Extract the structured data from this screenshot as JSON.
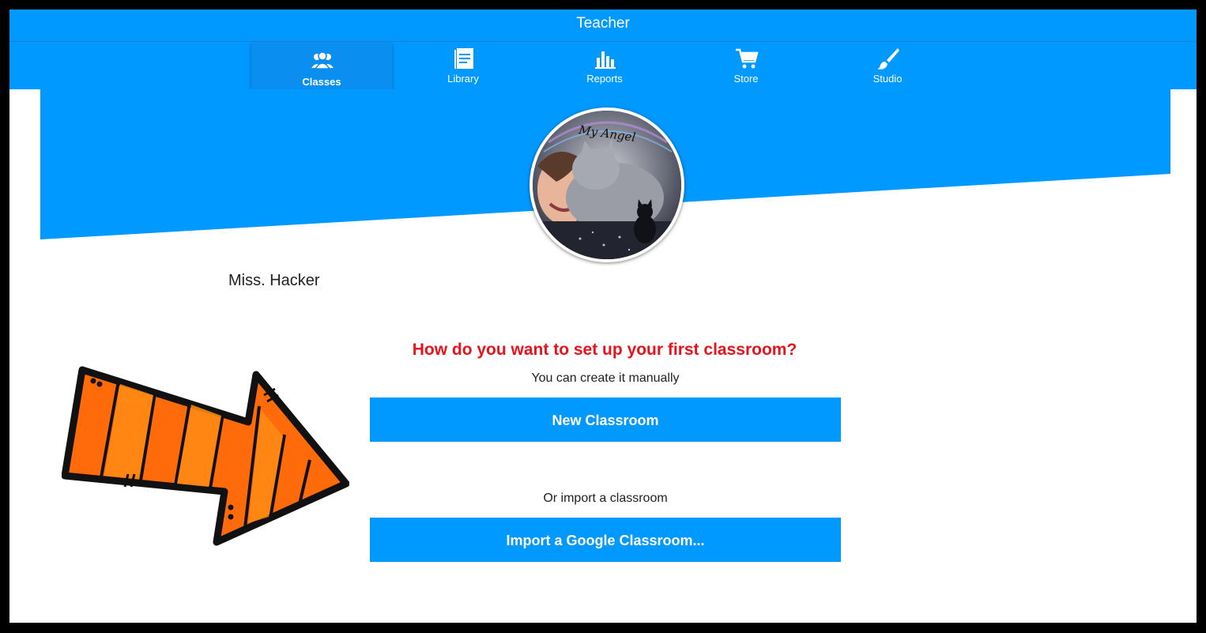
{
  "header": {
    "title": "Teacher"
  },
  "nav": {
    "items": [
      {
        "label": "Classes",
        "icon": "users-icon",
        "active": true
      },
      {
        "label": "Library",
        "icon": "book-icon",
        "active": false
      },
      {
        "label": "Reports",
        "icon": "bar-chart-icon",
        "active": false
      },
      {
        "label": "Store",
        "icon": "cart-icon",
        "active": false
      },
      {
        "label": "Studio",
        "icon": "paintbrush-icon",
        "active": false
      }
    ]
  },
  "profile": {
    "name": "Miss. Hacker",
    "avatar_caption": "My Angel"
  },
  "setup": {
    "question": "How do you want to set up your first classroom?",
    "manual_hint": "You can create it manually",
    "new_button": "New Classroom",
    "import_hint": "Or import a classroom",
    "import_button": "Import a Google Classroom..."
  },
  "colors": {
    "brand_blue": "#0099ff",
    "question_red": "#e8121c",
    "arrow_orange": "#ff6a0a",
    "arrow_light": "#ff8c14"
  }
}
